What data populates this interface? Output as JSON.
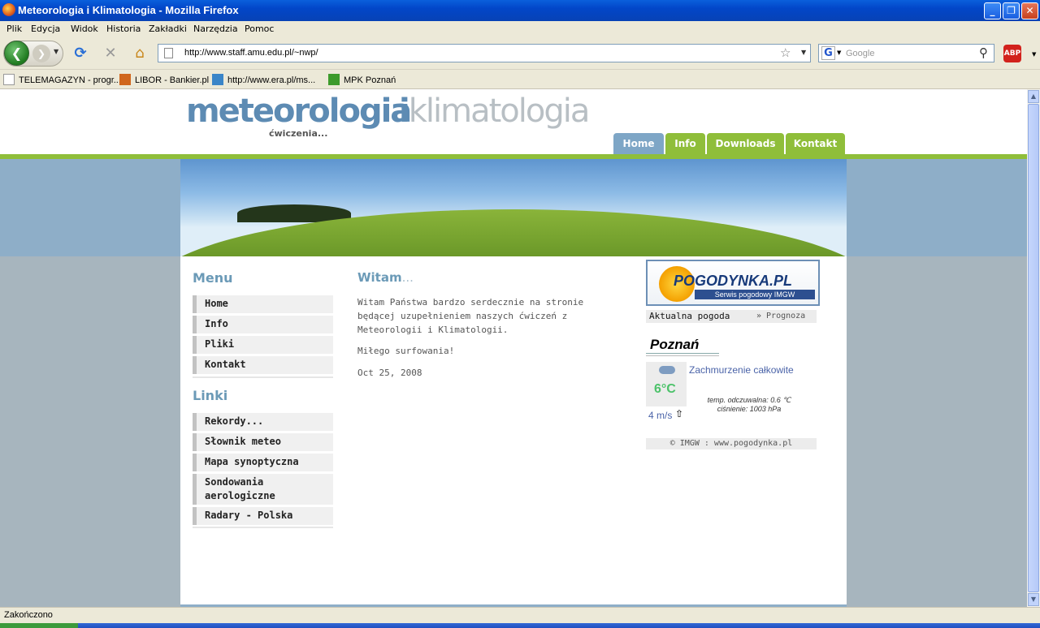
{
  "window": {
    "title": "Meteorologia i Klimatologia - Mozilla Firefox"
  },
  "menu": [
    "Plik",
    "Edycja",
    "Widok",
    "Historia",
    "Zakładki",
    "Narzędzia",
    "Pomoc"
  ],
  "toolbar": {
    "url": "http://www.staff.amu.edu.pl/~nwp/",
    "search_placeholder": "Google",
    "abp_label": "ABP"
  },
  "bookmarks": [
    "TELEMAGAZYN - progr...",
    "LIBOR - Bankier.pl",
    "http://www.era.pl/ms...",
    "MPK Poznań"
  ],
  "site": {
    "logo_part1": "meteorologia",
    "logo_i": "i",
    "logo_part2": "klimatologia",
    "logo_sub": "ćwiczenia...",
    "tabs": [
      "Home",
      "Info",
      "Downloads",
      "Kontakt"
    ]
  },
  "sidebar": {
    "menu_heading": "Menu",
    "menu": [
      "Home",
      "Info",
      "Pliki",
      "Kontakt"
    ],
    "links_heading": "Linki",
    "links": [
      "Rekordy...",
      "Słownik meteo",
      "Mapa synoptyczna",
      "Sondowania aerologiczne",
      "Radary - Polska"
    ]
  },
  "main": {
    "title": "Witam",
    "title_dots": "...",
    "paragraph1": "Witam Państwa bardzo serdecznie na stronie będącej uzupełnieniem naszych ćwiczeń z Meteorologii i Klimatologii.",
    "paragraph2": "Miłego surfowania!",
    "date": "Oct 25, 2008"
  },
  "weather": {
    "logo_name": "POGODYNKA.PL",
    "logo_sub": "Serwis pogodowy IMGW",
    "current_label": "Aktualna pogoda",
    "forecast_label": "» Prognoza",
    "city": "Poznań",
    "temperature": "6°C",
    "condition": "Zachmurzenie całkowite",
    "feels_like": "temp. odczuwalna: 0.6 ℃",
    "pressure": "ciśnienie: 1003 hPa",
    "wind": "4 m/s",
    "footer": "© IMGW : www.pogodynka.pl"
  },
  "status": {
    "text": "Zakończono"
  },
  "colors": {
    "accent_blue": "#6b9ab7",
    "accent_green": "#8fbe3a",
    "titlebar": "#0a5fdc"
  }
}
